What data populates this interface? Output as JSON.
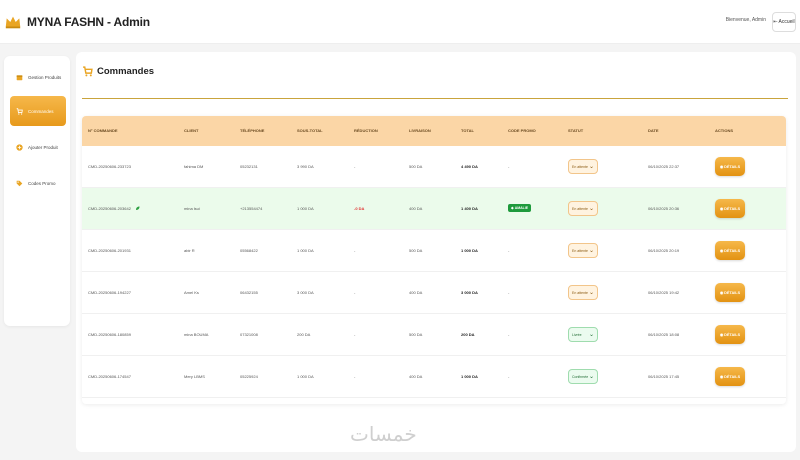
{
  "header": {
    "brand_title": "MYNA FASHN - Admin",
    "welcome": "Bienvenue, Admin",
    "home_label": "Accueil"
  },
  "sidebar": {
    "items": [
      {
        "label": "Gestion Produits",
        "icon": "box-icon",
        "active": false
      },
      {
        "label": "Commandes",
        "icon": "cart-icon",
        "active": true
      },
      {
        "label": "Ajouter Produit",
        "icon": "plus-circle-icon",
        "active": false
      },
      {
        "label": "Codes Promo",
        "icon": "tag-icon",
        "active": false
      }
    ]
  },
  "page": {
    "title": "Commandes"
  },
  "table": {
    "headers": [
      "N° COMMANDE",
      "CLIENT",
      "TÉLÉPHONE",
      "SOUS-TOTAL",
      "RÉDUCTION",
      "LIVRAISON",
      "TOTAL",
      "CODE PROMO",
      "STATUT",
      "DATE",
      "ACTIONS"
    ],
    "rows": [
      {
        "order": "CMD-20250606-233723",
        "client": "fahima DM",
        "phone": "05232131",
        "subtotal": "3 990 DA",
        "discount": "-",
        "delivery": "500 DA",
        "total": "4 490 DA",
        "promo": "-",
        "status": "En attente",
        "date": "06/10/2025 22:37",
        "action": "DÉTAILS"
      },
      {
        "order": "CMD-20250606-203642",
        "client": "mina lsui",
        "phone": "+213554474",
        "subtotal": "1 000 DA",
        "discount": "-0 DA",
        "delivery": "400 DA",
        "total": "1 400 DA",
        "promo": "AMALIE",
        "status": "En attente",
        "date": "06/10/2025 20:36",
        "action": "DÉTAILS"
      },
      {
        "order": "CMD-20250606-201931",
        "client": "abir R",
        "phone": "05568422",
        "subtotal": "1 000 DA",
        "discount": "-",
        "delivery": "500 DA",
        "total": "1 000 DA",
        "promo": "-",
        "status": "En attente",
        "date": "06/10/2025 20:19",
        "action": "DÉTAILS"
      },
      {
        "order": "CMD-20250606-194227",
        "client": "Amel Ks",
        "phone": "06432155",
        "subtotal": "3 000 DA",
        "discount": "-",
        "delivery": "400 DA",
        "total": "3 000 DA",
        "promo": "-",
        "status": "En attente",
        "date": "06/10/2025 19:42",
        "action": "DÉTAILS"
      },
      {
        "order": "CMD-20250606-180859",
        "client": "mina BOUMA",
        "phone": "07321008",
        "subtotal": "200 DA",
        "discount": "-",
        "delivery": "500 DA",
        "total": "200 DA",
        "promo": "-",
        "status": "Livrée",
        "date": "06/10/2025 18:08",
        "action": "DÉTAILS"
      },
      {
        "order": "CMD-20250606-174547",
        "client": "Mery LBMS",
        "phone": "05225924",
        "subtotal": "1 000 DA",
        "discount": "-",
        "delivery": "400 DA",
        "total": "1 000 DA",
        "promo": "-",
        "status": "Confirmée",
        "date": "06/10/2025 17:45",
        "action": "DÉTAILS"
      }
    ]
  },
  "watermark": "خمسات",
  "colors": {
    "accent": "#f0a62c",
    "header_row": "#fbd6a6",
    "highlight_row": "#ebfbeb",
    "promo_badge": "#1e9a3c",
    "discount": "#e23030"
  }
}
